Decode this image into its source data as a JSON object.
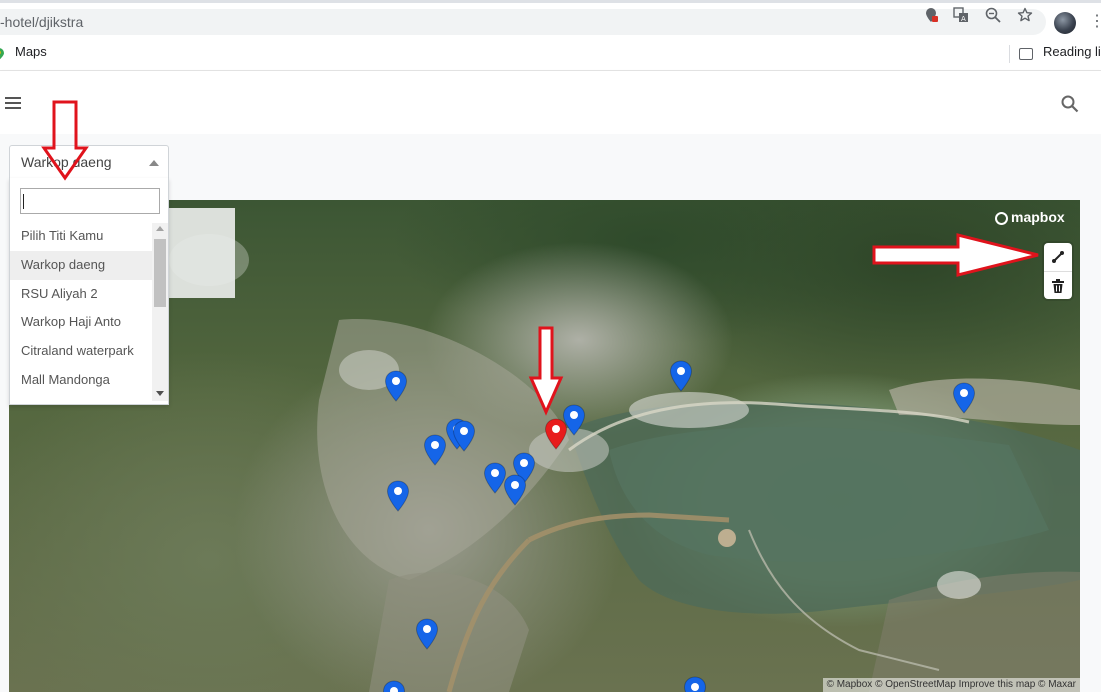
{
  "browser": {
    "url": "-hotel/djikstra",
    "bookmark_maps": "Maps",
    "reading_list": "Reading lis",
    "icons": [
      "location-blocked-icon",
      "translate-icon",
      "zoom-out-icon",
      "star-icon",
      "profile-avatar",
      "more-icon"
    ]
  },
  "app": {
    "menu_icon": "hamburger-icon",
    "search_icon": "search-icon"
  },
  "select": {
    "value": "Warkop daeng",
    "search_value": "",
    "options": [
      {
        "label": "Pilih Titi Kamu"
      },
      {
        "label": "Warkop daeng"
      },
      {
        "label": "RSU Aliyah 2"
      },
      {
        "label": "Warkop Haji Anto"
      },
      {
        "label": "Citraland waterpark"
      },
      {
        "label": "Mall Mandonga"
      }
    ]
  },
  "map": {
    "logo": "mapbox",
    "attribution": "© Mapbox © OpenStreetMap Improve this map © Maxar",
    "controls": [
      "line-draw-icon",
      "trash-icon"
    ],
    "marker_color": "#1565e8",
    "selected_marker_color": "#e81c1c"
  }
}
